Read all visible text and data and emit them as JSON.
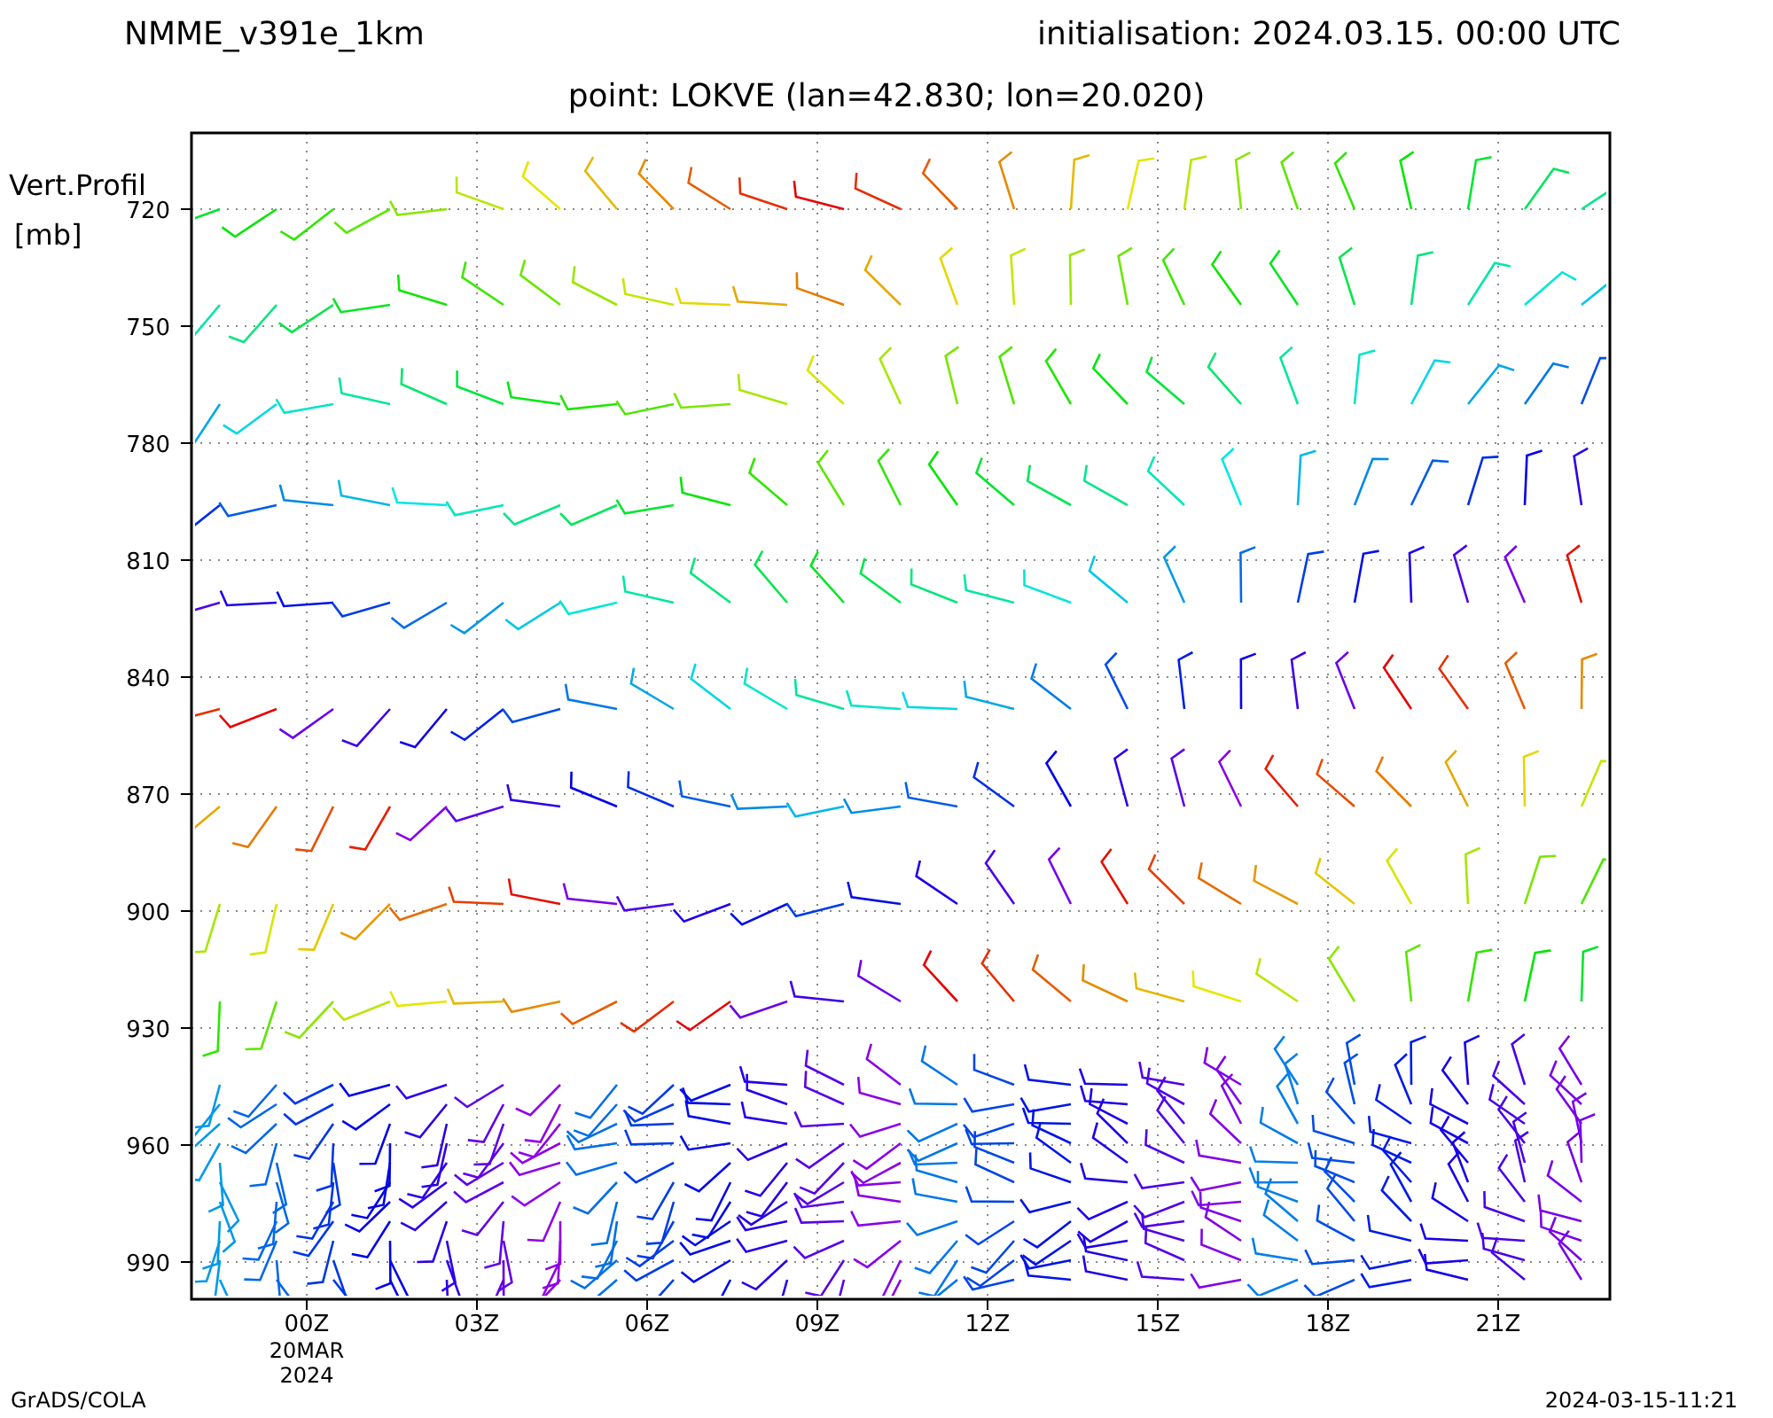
{
  "header": {
    "model": "NMME_v391e_1km",
    "initialisation": "initialisation: 2024.03.15. 00:00 UTC"
  },
  "point_title": "point: LOKVE (lan=42.830; lon=20.020)",
  "chart": {
    "y_axis_title": [
      "Vert.Profil",
      "[mb]"
    ],
    "y_ticks": [
      "720",
      "750",
      "780",
      "810",
      "840",
      "870",
      "900",
      "930",
      "960",
      "990"
    ],
    "x_ticks": [
      {
        "label": "00Z",
        "date": [
          "20MAR",
          "2024"
        ]
      },
      {
        "label": "03Z"
      },
      {
        "label": "06Z"
      },
      {
        "label": "09Z"
      },
      {
        "label": "12Z"
      },
      {
        "label": "15Z"
      },
      {
        "label": "18Z"
      },
      {
        "label": "21Z"
      }
    ]
  },
  "footer": {
    "left": "GrADS/COLA",
    "right": "2024-03-15-11:21"
  }
}
